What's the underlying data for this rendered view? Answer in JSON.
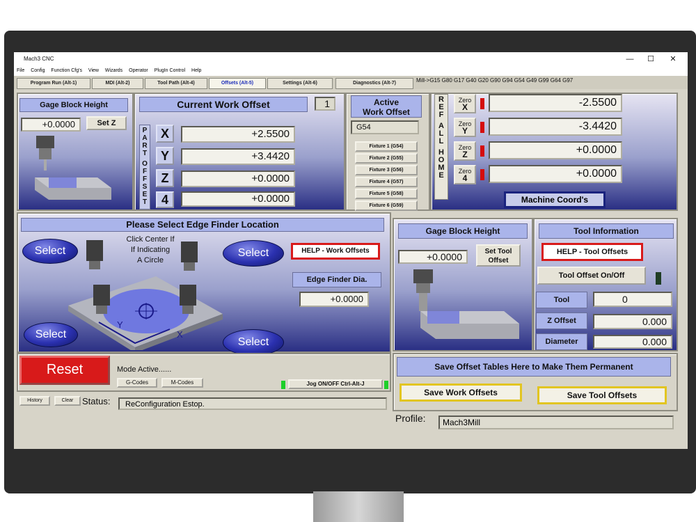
{
  "window": {
    "title": "Mach3 CNC"
  },
  "menu": [
    "File",
    "Config",
    "Function Cfg's",
    "View",
    "Wizards",
    "Operator",
    "PlugIn Control",
    "Help"
  ],
  "tabs": [
    "Program Run (Alt-1)",
    "MDI (Alt-2)",
    "Tool Path (Alt-4)",
    "Offsets (Alt-5)",
    "Settings (Alt-6)",
    "Diagnostics (Alt-7)"
  ],
  "active_tab": "Offsets (Alt-5)",
  "modal_gcodes": "Mill->G15  G80 G17 G40 G20 G90 G94 G54 G49 G99 G64 G97",
  "gage_block": {
    "header": "Gage Block Height",
    "value": "+0.0000",
    "set_z": "Set Z"
  },
  "current_offset": {
    "header": "Current Work Offset",
    "number": "1",
    "part_offset_letters": [
      "P",
      "A",
      "R",
      "T",
      "",
      "O",
      "F",
      "F",
      "S",
      "E",
      "T"
    ],
    "axes": [
      {
        "label": "X",
        "value": "+2.5500"
      },
      {
        "label": "Y",
        "value": "+3.4420"
      },
      {
        "label": "Z",
        "value": "+0.0000"
      },
      {
        "label": "4",
        "value": "+0.0000"
      }
    ]
  },
  "active_work_offset": {
    "header_line1": "Active",
    "header_line2": "Work Offset",
    "value": "G54",
    "fixtures": [
      "Fixture 1 (G54)",
      "Fixture 2 (G55)",
      "Fixture 3 (G56)",
      "Fixture 4 (G57)",
      "Fixture 5 (G58)",
      "Fixture 6 (G59)"
    ]
  },
  "ref_all_home": {
    "letters": [
      "R",
      "E",
      "F",
      "",
      "A",
      "L",
      "L",
      "",
      "H",
      "O",
      "M",
      "E"
    ],
    "axes": [
      {
        "zero_top": "Zero",
        "zero_axis": "X",
        "value": "-2.5500"
      },
      {
        "zero_top": "Zero",
        "zero_axis": "Y",
        "value": "-3.4420"
      },
      {
        "zero_top": "Zero",
        "zero_axis": "Z",
        "value": "+0.0000"
      },
      {
        "zero_top": "Zero",
        "zero_axis": "4",
        "value": "+0.0000"
      }
    ],
    "machine_coords": "Machine Coord's"
  },
  "edge_finder": {
    "header": "Please Select Edge Finder Location",
    "select": "Select",
    "center_note_1": "Click Center If",
    "center_note_2": "If Indicating",
    "center_note_3": "A Circle",
    "help": "HELP - Work Offsets",
    "dia_label": "Edge Finder Dia.",
    "dia_value": "+0.0000",
    "axis_y": "Y",
    "axis_x": "X"
  },
  "gage_block_2": {
    "header": "Gage Block Height",
    "value": "+0.0000",
    "set_tool_1": "Set Tool",
    "set_tool_2": "Offset"
  },
  "tool_info": {
    "header": "Tool Information",
    "help": "HELP - Tool Offsets",
    "toggle": "Tool Offset On/Off",
    "tool_label": "Tool",
    "tool_value": "0",
    "zoff_label": "Z Offset",
    "zoff_value": "0.000",
    "dia_label": "Diameter",
    "dia_value": "0.000"
  },
  "save_tables": {
    "header": "Save Offset Tables Here to Make Them Permanent",
    "work": "Save Work Offsets",
    "tool": "Save Tool Offsets"
  },
  "bottom": {
    "reset": "Reset",
    "mode_active": "Mode Active......",
    "gcodes": "G-Codes",
    "mcodes": "M-Codes",
    "jog": "Jog ON/OFF Ctrl-Alt-J",
    "history": "History",
    "clear": "Clear",
    "status_label": "Status:",
    "status_text": "ReConfiguration Estop.",
    "profile_label": "Profile:",
    "profile_value": "Mach3Mill"
  }
}
